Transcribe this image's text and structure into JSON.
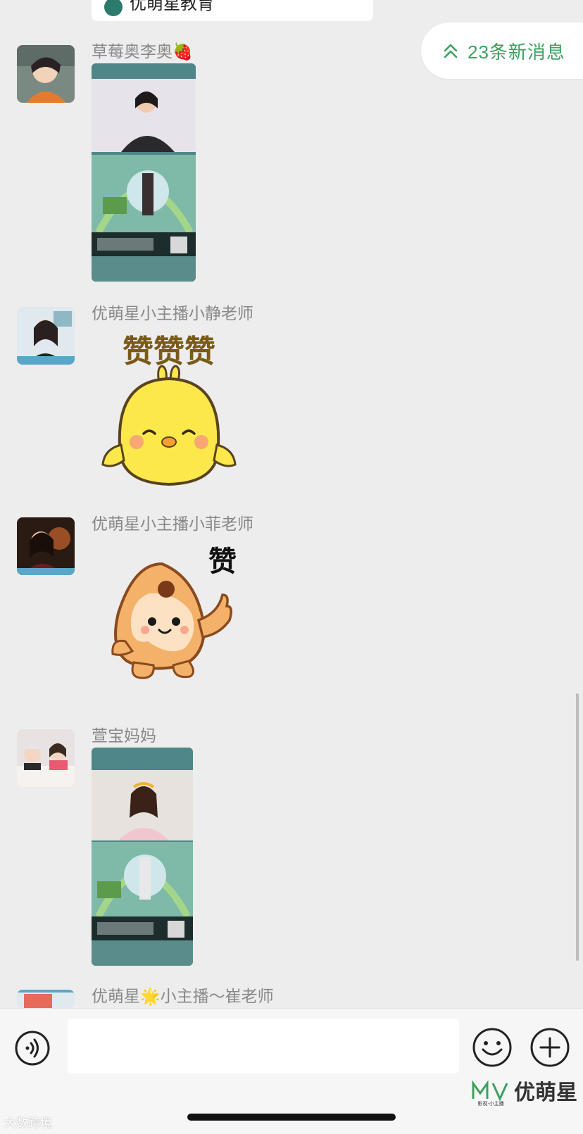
{
  "top_card": {
    "title": "优萌星教育"
  },
  "new_messages": {
    "label": "23条新消息"
  },
  "messages": [
    {
      "sender": "草莓奥李奥🍓",
      "type": "image"
    },
    {
      "sender": "优萌星小主播小静老师",
      "type": "sticker",
      "sticker_text": "赞赞赞"
    },
    {
      "sender": "优萌星小主播小菲老师",
      "type": "sticker",
      "sticker_text": "赞"
    },
    {
      "sender": "萱宝妈妈",
      "type": "image"
    },
    {
      "sender": "优萌星🌟小主播～崔老师",
      "type": "text"
    }
  ],
  "input_bar": {
    "input_value": "",
    "voice_icon": "voice-icon",
    "emoji_icon": "emoji-icon",
    "plus_icon": "plus-icon"
  },
  "brand": {
    "name": "优萌星",
    "sub": "影视·小主播"
  },
  "watermark": "大数跨境",
  "colors": {
    "accent_green": "#3aa25f",
    "background": "#ededed",
    "chick_yellow": "#fce84a",
    "mascot_orange": "#f3b16a"
  }
}
